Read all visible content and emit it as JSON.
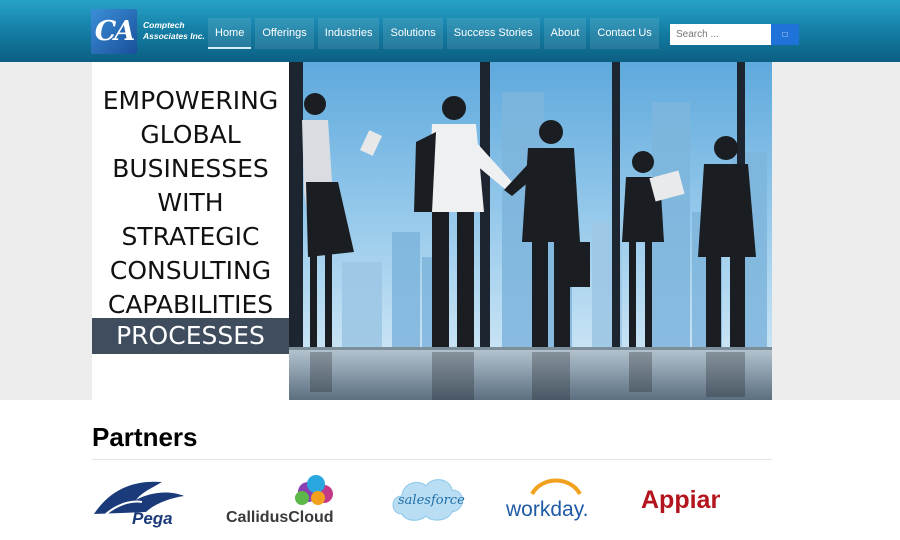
{
  "brand": {
    "mark": "CA",
    "name": "Comptech\nAssociates Inc."
  },
  "nav": {
    "items": [
      {
        "label": "Home"
      },
      {
        "label": "Offerings"
      },
      {
        "label": "Industries"
      },
      {
        "label": "Solutions"
      },
      {
        "label": "Success Stories"
      },
      {
        "label": "About"
      },
      {
        "label": "Contact Us"
      }
    ],
    "active": "Home"
  },
  "search": {
    "placeholder": "Search ...",
    "icon": "search-icon"
  },
  "hero": {
    "lines": [
      "EMPOWERING",
      "GLOBAL",
      "BUSINESSES",
      "WITH",
      "STRATEGIC",
      "CONSULTING",
      "CAPABILITIES"
    ],
    "band_label": "PROCESSES"
  },
  "partners": {
    "title": "Partners",
    "logos": [
      {
        "name": "Pega",
        "color": "#1b3a79"
      },
      {
        "name": "CallidusCloud",
        "color": "#3a3a3a"
      },
      {
        "name": "salesforce",
        "color": "#1f8fd6"
      },
      {
        "name": "workday.",
        "color": "#1f5aa6"
      },
      {
        "name": "Appian",
        "color": "#b3141d"
      }
    ]
  },
  "colors": {
    "header": "#137aa1",
    "search_button": "#1f73d8"
  }
}
